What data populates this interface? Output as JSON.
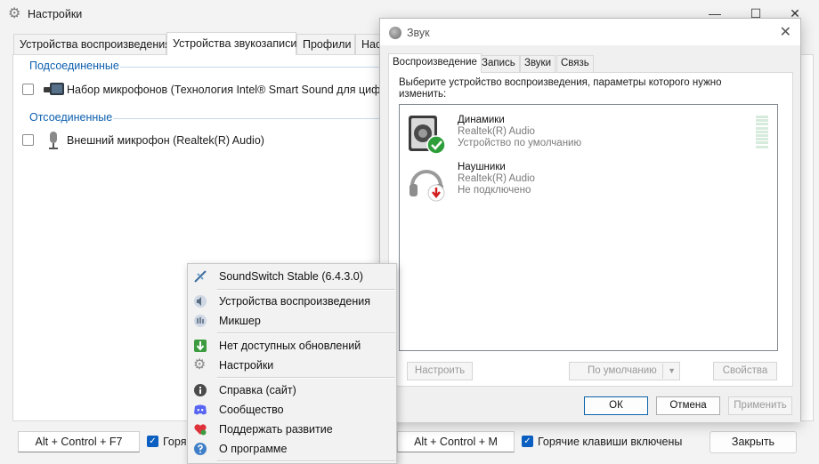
{
  "settings_window": {
    "title": "Настройки",
    "controls": {
      "minimize": "—",
      "maximize": "☐",
      "close": "✕"
    },
    "tabs": [
      "Устройства воспроизведения",
      "Устройства звукозаписи",
      "Профили",
      "Наст"
    ],
    "groups": {
      "connected": {
        "header": "Подсоединенные",
        "devices": [
          "Набор микрофонов (Технология Intel® Smart Sound для цифро"
        ]
      },
      "disconnected": {
        "header": "Отсоединенные",
        "devices": [
          "Внешний микрофон (Realtek(R) Audio)"
        ]
      }
    },
    "bottom": {
      "hotkey_left": "Alt + Control + F7",
      "hotkey_left_checkbox_label": "Горяч",
      "hotkey_right": "Alt + Control + M",
      "hotkey_right_checkbox_label": "Горячие клавиши включены",
      "close_button": "Закрыть"
    }
  },
  "sound_dialog": {
    "title": "Звук",
    "tabs": [
      "Воспроизведение",
      "Запись",
      "Звуки",
      "Связь"
    ],
    "description": "Выберите устройство воспроизведения, параметры которого нужно изменить:",
    "devices": [
      {
        "name": "Динамики",
        "driver": "Realtek(R) Audio",
        "status": "Устройство по умолчанию",
        "badge": "default-check"
      },
      {
        "name": "Наушники",
        "driver": "Realtek(R) Audio",
        "status": "Не подключено",
        "badge": "disconnected-arrow"
      }
    ],
    "buttons": {
      "configure": "Настроить",
      "set_default": "По умолчанию",
      "properties": "Свойства",
      "ok": "ОК",
      "cancel": "Отмена",
      "apply": "Применить"
    }
  },
  "context_menu": {
    "items": [
      {
        "label": "SoundSwitch Stable (6.4.3.0)",
        "icon": "soundswitch-icon"
      },
      {
        "label": "Устройства воспроизведения",
        "icon": "speaker-icon"
      },
      {
        "label": "Микшер",
        "icon": "mixer-icon"
      },
      {
        "label": "Нет доступных обновлений",
        "icon": "update-icon"
      },
      {
        "label": "Настройки",
        "icon": "gear-icon"
      },
      {
        "label": "Справка (сайт)",
        "icon": "info-icon"
      },
      {
        "label": "Сообщество",
        "icon": "discord-icon"
      },
      {
        "label": "Поддержать развитие",
        "icon": "heart-icon"
      },
      {
        "label": "О программе",
        "icon": "help-icon"
      }
    ]
  },
  "colors": {
    "accent": "#0a5fc1",
    "group_header": "#0d5fae",
    "default_badge": "#2e9e3a",
    "disconnected_badge": "#d11f1f"
  }
}
